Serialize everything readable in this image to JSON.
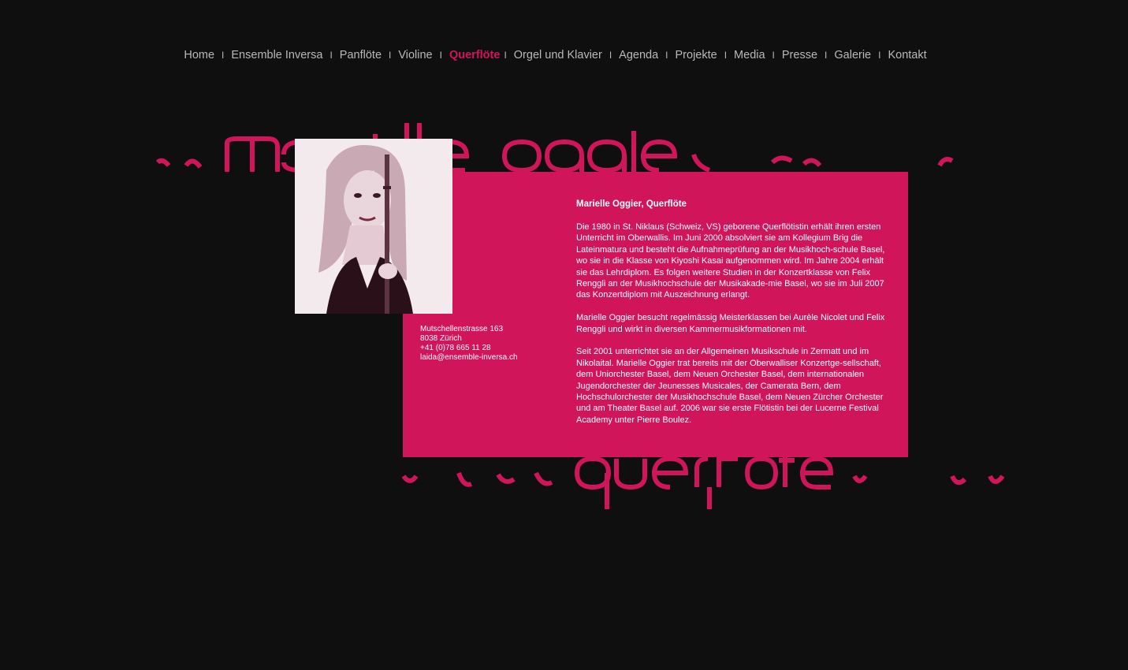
{
  "nav": {
    "items": [
      {
        "label": "Home"
      },
      {
        "label": "Ensemble Inversa"
      },
      {
        "label": "Panflöte"
      },
      {
        "label": "Violine"
      },
      {
        "label": "Querflöte",
        "active": true
      },
      {
        "label": "Orgel und Klavier"
      },
      {
        "label": "Agenda"
      },
      {
        "label": "Projekte"
      },
      {
        "label": "Media"
      },
      {
        "label": "Presse"
      },
      {
        "label": "Galerie"
      },
      {
        "label": "Kontakt"
      }
    ],
    "separator": "I"
  },
  "decorative": {
    "top_word": "marielle oggier",
    "bottom_word": "querflöte"
  },
  "contact": {
    "street": "Mutschellenstrasse 163",
    "city": "8038 Zürich",
    "phone": "+41 (0)78 665 11 28",
    "email": "laida@ensemble-inversa.ch"
  },
  "bio": {
    "heading": "Marielle Oggier, Querflöte",
    "paragraphs": [
      "Die 1980 in St. Niklaus (Schweiz, VS) geborene Querflötistin erhält ihren ersten Unterricht im Oberwallis. Im Juni 2000 absolviert sie am Kollegium Brig die Lateinmatura und besteht die Aufnahmeprüfung an der Musikhoch-schule Basel, wo sie in die Klasse von Kiyoshi Kasai aufgenommen wird. Im Jahre 2004 erhält sie das Lehrdiplom. Es folgen weitere Studien in der Konzertklasse von Felix Renggli an der Musikhochschule der Musikakade-mie Basel, wo sie im Juli 2007 das Konzertdiplom mit Auszeichnung erlangt.",
      "Marielle Oggier besucht regelmässig Meisterklassen bei Aurèle Nicolet und Felix Renggli und wirkt in diversen Kammermusikformationen mit.",
      "Seit 2001 unterrichtet sie an der Allgemeinen Musikschule in Zermatt und im Nikolaital. Marielle Oggier trat bereits mit der Oberwalliser Konzertge-sellschaft, dem Uniorchester Basel, dem Neuen Orchester Basel, dem internationalen Jugendorchester der Jeunesses Musicales, der Camerata Bern, dem Hochschulorchester der Musikhochschule Basel, dem Neuen Zürcher Orchester und am Theater Basel auf. 2006 war sie erste Flötistin bei der Lucerne Festival Academy unter Pierre Boulez."
    ]
  },
  "colors": {
    "accent": "#d0155a",
    "background": "#0f0f0f",
    "nav_text": "#b9b9b9"
  }
}
